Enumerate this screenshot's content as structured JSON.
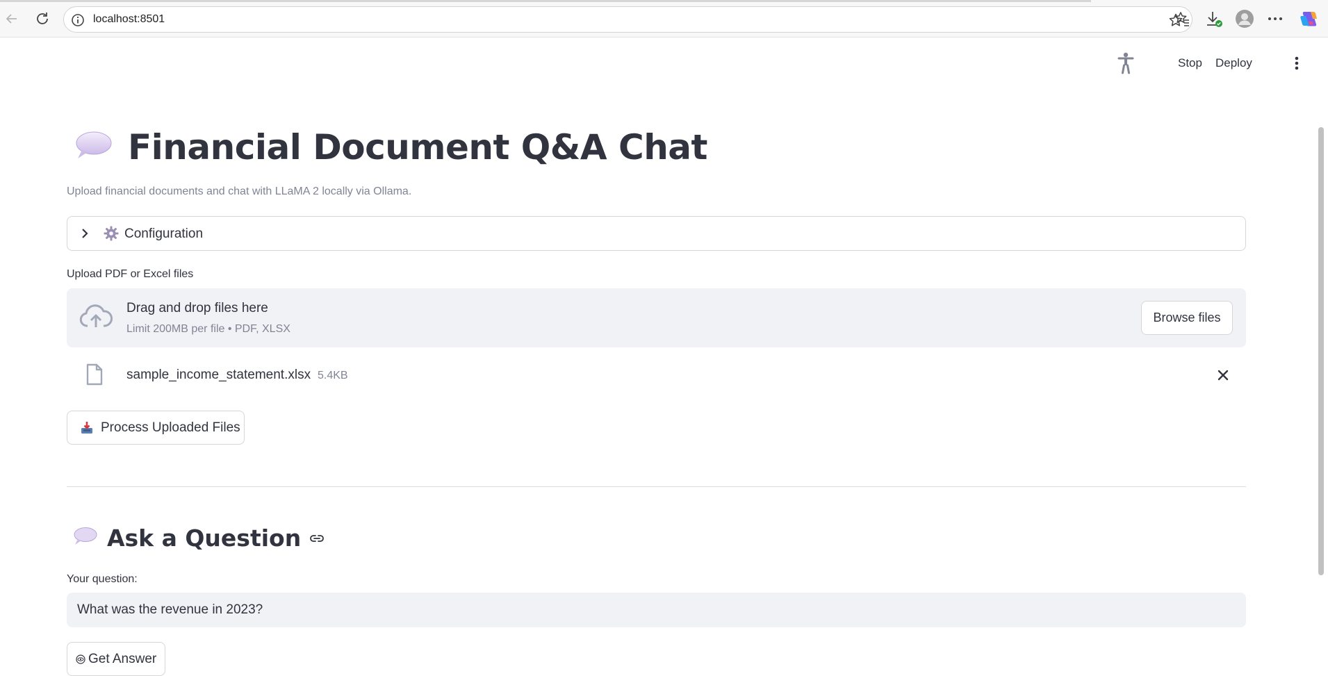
{
  "browser": {
    "url": "localhost:8501",
    "icons": [
      "back-icon",
      "reload-icon",
      "info-icon",
      "star-icon",
      "favorites-icon",
      "downloads-icon",
      "profile-icon",
      "more-icon",
      "copilot-icon"
    ]
  },
  "app_header": {
    "stop_label": "Stop",
    "deploy_label": "Deploy"
  },
  "main": {
    "title_emoji": "💬",
    "title": "Financial Document Q&A Chat",
    "subtitle": "Upload financial documents and chat with LLaMA 2 locally via Ollama.",
    "config_expander_label": "Configuration",
    "upload": {
      "label": "Upload PDF or Excel files",
      "dropzone_title": "Drag and drop files here",
      "dropzone_limit": "Limit 200MB per file • PDF, XLSX",
      "browse_label": "Browse files",
      "files": [
        {
          "name": "sample_income_statement.xlsx",
          "size": "5.4KB"
        }
      ]
    },
    "process_button_label": "Process Uploaded Files",
    "question_section": {
      "heading": "Ask a Question",
      "input_label": "Your question:",
      "input_value": "What was the revenue in 2023?",
      "answer_button_label": "Get Answer"
    }
  },
  "colors": {
    "text": "#31333f",
    "muted": "#808495",
    "input_bg": "#f0f2f6",
    "border": "#d6d6d9"
  }
}
